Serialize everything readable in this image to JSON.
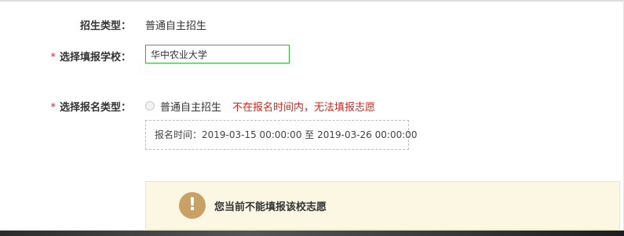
{
  "form": {
    "enroll_type": {
      "label": "招生类型：",
      "value": "普通自主招生"
    },
    "school": {
      "required_mark": "*",
      "label": "选择填报学校：",
      "value": "华中农业大学"
    },
    "apply_type": {
      "required_mark": "*",
      "label": "选择报名类型：",
      "option_label": "普通自主招生",
      "warning": "不在报名时间内，无法填报志愿",
      "time_text": "报名时间：2019-03-15 00:00:00 至 2019-03-26 00:00:00"
    }
  },
  "notice": {
    "icon_glyph": "!",
    "icon_name": "exclamation-icon",
    "text": "您当前不能填报该校志愿"
  },
  "colors": {
    "required": "#e02424",
    "warning": "#d9241c",
    "input_border": "#3fae3f",
    "notice_bg": "#fcf7e3",
    "notice_icon": "#c9a066"
  }
}
